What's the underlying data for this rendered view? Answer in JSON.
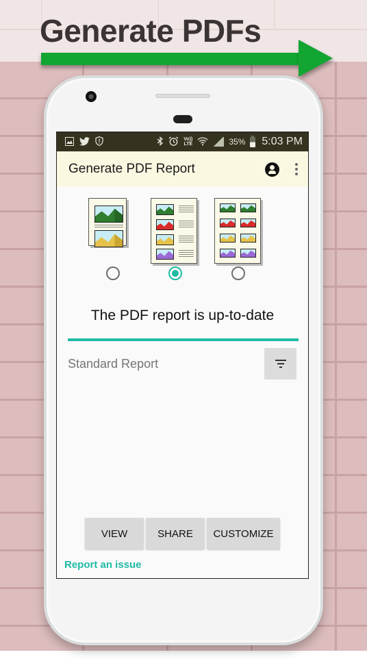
{
  "promo": {
    "headline": "Generate PDFs",
    "arrow_color": "#12a532"
  },
  "statusbar": {
    "left_icons": [
      "image-icon",
      "twitter-icon",
      "shield-alert-icon"
    ],
    "right_icons": [
      "bluetooth-icon",
      "alarm-icon",
      "volte-icon",
      "wifi-icon",
      "signal-icon",
      "battery-icon"
    ],
    "volte_label_top": "Vo))",
    "volte_label_bottom": "LTE",
    "battery_percent": "35%",
    "time": "5:03 PM"
  },
  "appbar": {
    "title": "Generate PDF Report",
    "actions": [
      "account-icon",
      "more-vert-icon"
    ]
  },
  "templates": {
    "options": [
      {
        "name": "large-images-layout",
        "selected": false,
        "colors": [
          "#2f7d2f",
          "#e6c24a"
        ]
      },
      {
        "name": "images-with-text-layout",
        "selected": true,
        "colors": [
          "#2f7d2f",
          "#d92b2b",
          "#e6c24a",
          "#9a6ad6"
        ]
      },
      {
        "name": "image-grid-layout",
        "selected": false,
        "colors": [
          "#2f7d2f",
          "#d92b2b",
          "#e6c24a",
          "#9a6ad6"
        ]
      }
    ],
    "selected_index": 1
  },
  "main": {
    "status_text": "The PDF report is up-to-date",
    "progress": 1.0,
    "report_type": "Standard Report",
    "filter_icon": "filter-list-icon"
  },
  "actions": {
    "view_label": "VIEW",
    "share_label": "SHARE",
    "customize_label": "CUSTOMIZE",
    "report_issue_label": "Report an issue"
  },
  "colors": {
    "accent": "#1ebaa5",
    "appbar_bg": "#fbf8e2",
    "statusbar_bg": "#35321f",
    "button_bg": "#d9d9d9"
  }
}
